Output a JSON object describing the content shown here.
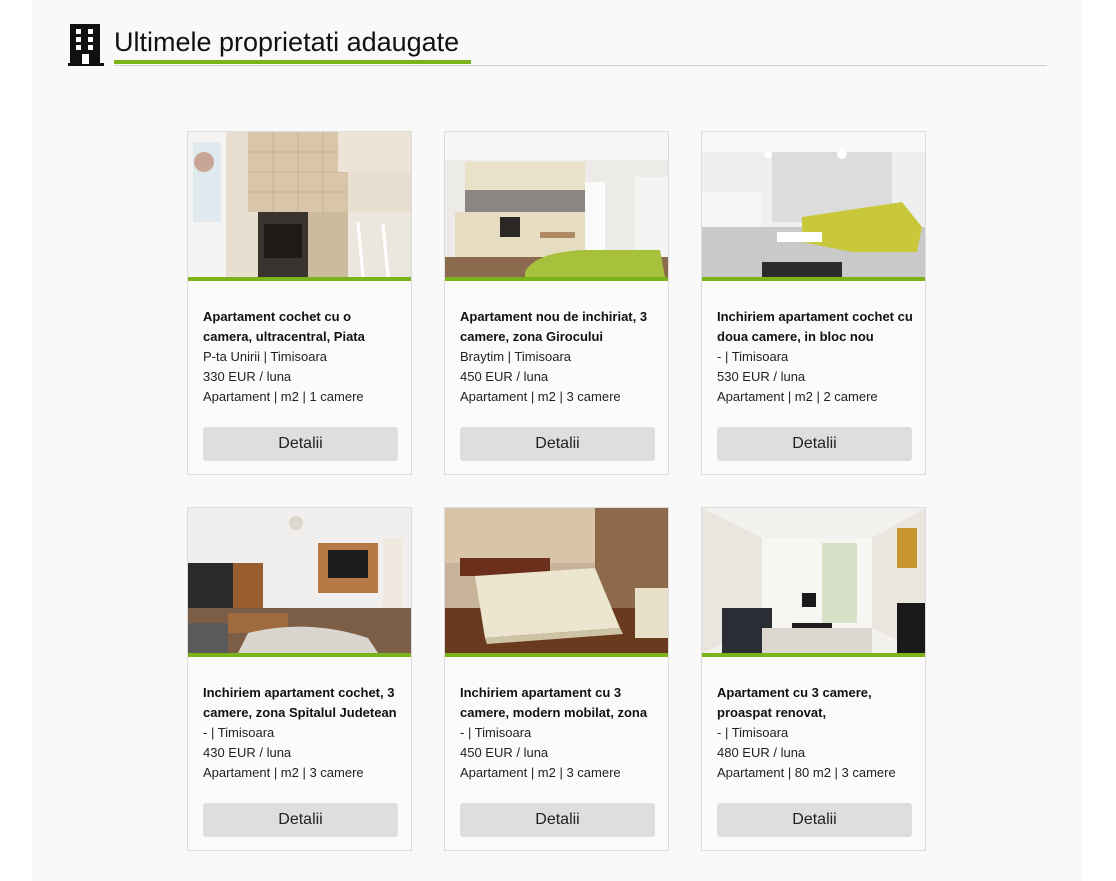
{
  "section": {
    "title": "Ultimele proprietati adaugate",
    "icon": "building-icon",
    "accent_color": "#7bb31a"
  },
  "listings": [
    {
      "title": "Apartament cochet cu o camera, ultracentral, Piata",
      "location": "P-ta Unirii | Timisoara",
      "price": "330 EUR / luna",
      "details": "Apartament | m2 | 1 camere",
      "button": "Detalii",
      "photo": "kitchen-photo"
    },
    {
      "title": "Apartament nou de inchiriat, 3 camere, zona Girocului",
      "location": "Braytim | Timisoara",
      "price": "450 EUR / luna",
      "details": "Apartament | m2 | 3 camere",
      "button": "Detalii",
      "photo": "open-kitchen-living-photo"
    },
    {
      "title": "Inchiriem apartament cochet cu doua camere, in bloc nou",
      "location": "- | Timisoara",
      "price": "530 EUR / luna",
      "details": "Apartament | m2 | 2 camere",
      "button": "Detalii",
      "photo": "living-room-sofa-photo"
    },
    {
      "title": "Inchiriem apartament cochet, 3 camere, zona Spitalul Judetean",
      "location": "- | Timisoara",
      "price": "430 EUR / luna",
      "details": "Apartament | m2 | 3 camere",
      "button": "Detalii",
      "photo": "living-room-tv-photo"
    },
    {
      "title": "Inchiriem apartament cu 3 camere, modern mobilat, zona",
      "location": "- | Timisoara",
      "price": "450 EUR / luna",
      "details": "Apartament | m2 | 3 camere",
      "button": "Detalii",
      "photo": "bedroom-photo"
    },
    {
      "title": "Apartament cu 3 camere, proaspat renovat,",
      "location": "- | Timisoara",
      "price": "480 EUR / luna",
      "details": "Apartament | 80 m2 | 3 camere",
      "button": "Detalii",
      "photo": "panorama-living-photo"
    }
  ]
}
